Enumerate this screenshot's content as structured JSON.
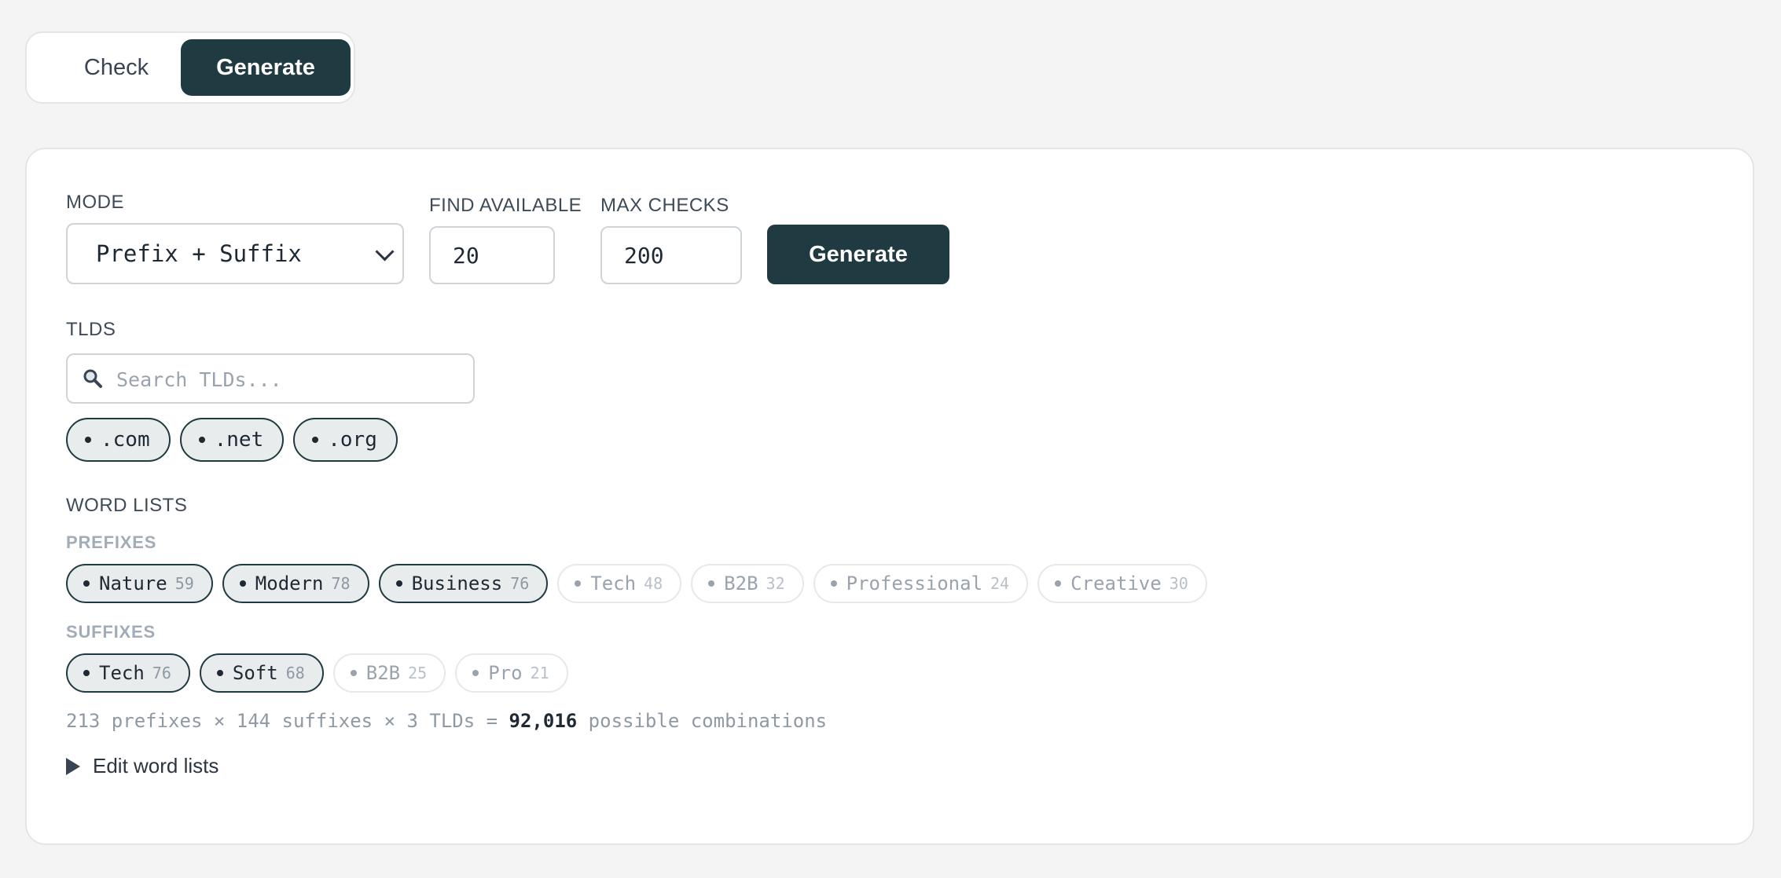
{
  "tabs": {
    "check": "Check",
    "generate": "Generate"
  },
  "form": {
    "mode_label": "MODE",
    "mode_value": "Prefix + Suffix",
    "find_label": "FIND AVAILABLE",
    "find_value": "20",
    "max_label": "MAX CHECKS",
    "max_value": "200",
    "generate_label": "Generate"
  },
  "tlds": {
    "label": "TLDS",
    "search_placeholder": "Search TLDs...",
    "items": [
      ".com",
      ".net",
      ".org"
    ]
  },
  "word_lists": {
    "label": "WORD LISTS",
    "prefixes_label": "PREFIXES",
    "prefixes": [
      {
        "name": "Nature",
        "count": "59",
        "selected": true
      },
      {
        "name": "Modern",
        "count": "78",
        "selected": true
      },
      {
        "name": "Business",
        "count": "76",
        "selected": true
      },
      {
        "name": "Tech",
        "count": "48",
        "selected": false
      },
      {
        "name": "B2B",
        "count": "32",
        "selected": false
      },
      {
        "name": "Professional",
        "count": "24",
        "selected": false
      },
      {
        "name": "Creative",
        "count": "30",
        "selected": false
      }
    ],
    "suffixes_label": "SUFFIXES",
    "suffixes": [
      {
        "name": "Tech",
        "count": "76",
        "selected": true
      },
      {
        "name": "Soft",
        "count": "68",
        "selected": true
      },
      {
        "name": "B2B",
        "count": "25",
        "selected": false
      },
      {
        "name": "Pro",
        "count": "21",
        "selected": false
      }
    ]
  },
  "combinations": {
    "prefix_text": "213 prefixes × 144 suffixes × 3 TLDs = ",
    "total": "92,016",
    "suffix_text": " possible combinations"
  },
  "edit_label": "Edit word lists",
  "colors": {
    "accent": "#1f3a41",
    "background": "#f3f4f3",
    "muted": "#9aa3ad"
  }
}
